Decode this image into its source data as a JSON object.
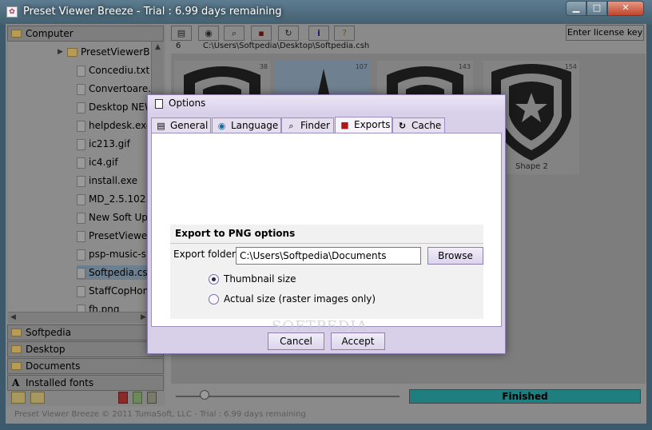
{
  "window": {
    "title": "Preset Viewer Breeze - Trial : 6.99 days remaining",
    "app_icon_glyph": "✿",
    "minimize_glyph": "▁",
    "maximize_glyph": "□",
    "close_glyph": "✕"
  },
  "left_panel": {
    "computer_label": "Computer",
    "tree_items": [
      {
        "label": "PresetViewerB",
        "type": "folder"
      },
      {
        "label": "Concediu.txt",
        "type": "file"
      },
      {
        "label": "Convertoare.tx",
        "type": "file"
      },
      {
        "label": "Desktop NEW",
        "type": "file"
      },
      {
        "label": "helpdesk.exe",
        "type": "file"
      },
      {
        "label": "ic213.gif",
        "type": "file"
      },
      {
        "label": "ic4.gif",
        "type": "file"
      },
      {
        "label": "install.exe",
        "type": "file"
      },
      {
        "label": "MD_2.5.102.",
        "type": "file"
      },
      {
        "label": "New Soft Upd",
        "type": "file"
      },
      {
        "label": "PresetViewer",
        "type": "file"
      },
      {
        "label": "psp-music-s",
        "type": "file"
      },
      {
        "label": "Softpedia.csh",
        "type": "file",
        "selected": true
      },
      {
        "label": "StaffCopHom",
        "type": "file"
      },
      {
        "label": "fh.png",
        "type": "file"
      }
    ],
    "accordion": [
      "Softpedia",
      "Desktop",
      "Documents",
      "Installed fonts"
    ]
  },
  "toolbar": {
    "license_button": "Enter license key",
    "path_count": "6",
    "path": "C:\\Users\\Softpedia\\Desktop\\Softpedia.csh"
  },
  "thumbnails": [
    {
      "number": "38",
      "caption": ""
    },
    {
      "number": "107",
      "caption": ""
    },
    {
      "number": "143",
      "caption": ""
    },
    {
      "number": "154",
      "caption": "Shape 2"
    }
  ],
  "bottom": {
    "slider_level": 0.13,
    "progress_label": "Finished",
    "status_text": "Preset Viewer Breeze © 2011 TumaSoft, LLC - Trial : 6.99 days remaining"
  },
  "dialog": {
    "title": "Options",
    "tabs": [
      {
        "label": "General",
        "icon": "general-icon"
      },
      {
        "label": "Language",
        "icon": "globe-icon"
      },
      {
        "label": "Finder",
        "icon": "magnifier-icon"
      },
      {
        "label": "Exports",
        "icon": "floppy-icon",
        "active": true
      },
      {
        "label": "Cache",
        "icon": "refresh-icon"
      }
    ],
    "section_title": "Export to PNG options",
    "export_folder_label": "Export folder",
    "export_folder_value": "C:\\Users\\Softpedia\\Documents",
    "browse_label": "Browse",
    "radio_thumbnail": "Thumbnail size",
    "radio_actual": "Actual size (raster images only)",
    "radio_selected": "thumbnail",
    "cancel_label": "Cancel",
    "accept_label": "Accept"
  },
  "watermark": "SOFTPEDIA"
}
